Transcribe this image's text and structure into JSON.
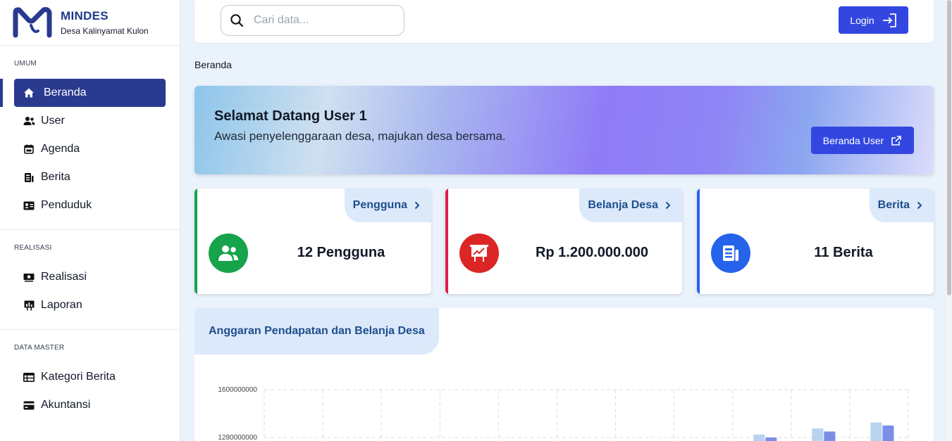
{
  "brand": {
    "name": "MINDES",
    "subtitle": "Desa Kalinyamat Kulon"
  },
  "sidebar": {
    "sections": [
      {
        "title": "UMUM",
        "items": [
          {
            "label": "Beranda",
            "icon": "home-icon",
            "active": true
          },
          {
            "label": "User",
            "icon": "users-icon"
          },
          {
            "label": "Agenda",
            "icon": "calendar-icon"
          },
          {
            "label": "Berita",
            "icon": "newspaper-icon"
          },
          {
            "label": "Penduduk",
            "icon": "id-card-icon"
          }
        ]
      },
      {
        "title": "REALISASI",
        "items": [
          {
            "label": "Realisasi",
            "icon": "money-icon"
          },
          {
            "label": "Laporan",
            "icon": "chart-board-icon"
          }
        ]
      },
      {
        "title": "DATA MASTER",
        "items": [
          {
            "label": "Kategori Berita",
            "icon": "table-icon"
          },
          {
            "label": "Akuntansi",
            "icon": "credit-card-icon"
          }
        ]
      }
    ]
  },
  "topbar": {
    "search_placeholder": "Cari data...",
    "login_label": "Login"
  },
  "breadcrumb": "Beranda",
  "hero": {
    "title": "Selamat Datang User 1",
    "subtitle": "Awasi penyelenggaraan desa, majukan desa bersama.",
    "button_label": "Beranda User"
  },
  "cards": [
    {
      "tag": "Pengguna",
      "value": "12 Pengguna",
      "color": "#16a34a",
      "icon": "users-icon"
    },
    {
      "tag": "Belanja Desa",
      "value": "Rp 1.200.000.000",
      "color": "#dc2626",
      "icon": "presentation-chart-icon"
    },
    {
      "tag": "Berita",
      "value": "11 Berita",
      "color": "#2563eb",
      "icon": "newspaper-icon"
    }
  ],
  "chart_panel": {
    "title": "Anggaran Pendapatan dan Belanja Desa"
  },
  "chart_data": {
    "type": "bar",
    "title": "",
    "ytick_labels": [
      "1600000000",
      "1280000000"
    ],
    "ylim": [
      1280000000,
      1600000000
    ],
    "grid": true,
    "series": [
      {
        "color": "#b7d3ee",
        "values": [
          1300000000,
          1340000000,
          1380000000
        ]
      },
      {
        "color": "#7c8de8",
        "values": [
          1280000000,
          1320000000,
          1360000000
        ]
      }
    ],
    "colors": {
      "grid": "#dddddd"
    }
  }
}
